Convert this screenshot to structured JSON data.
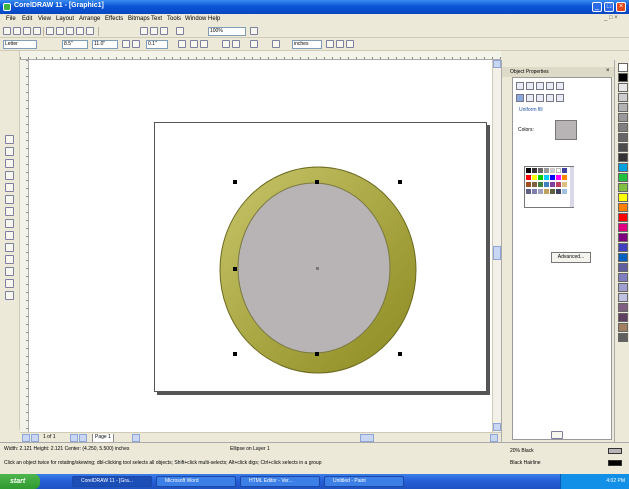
{
  "window": {
    "title": "CorelDRAW 11 - [Graphic1]",
    "minimize_glyph": "_",
    "maximize_glyph": "□",
    "close_glyph": "×"
  },
  "menu": {
    "items": [
      "File",
      "Edit",
      "View",
      "Layout",
      "Arrange",
      "Effects",
      "Bitmaps",
      "Text",
      "Tools",
      "Window",
      "Help"
    ],
    "doc_controls": "_ □ ×"
  },
  "toolbar": {
    "zoom_value": "100%",
    "paper_type": "Letter",
    "width_value": "8.5\"",
    "height_value": "11.0\"",
    "units_value": "inches",
    "nudge_value": "0.1\""
  },
  "docker": {
    "title": "Object Properties",
    "section_label": "Uniform fill",
    "colors_label": "Colors:",
    "advanced_button": "Advanced..."
  },
  "pages": {
    "counter": "1 of 1",
    "tab_label": "Page 1"
  },
  "status": {
    "line1": "Width: 2.121  Height: 2.121  Center: (4.250, 5.500)  inches",
    "layer_text": "Ellipse on Layer 1",
    "line2": "Click an object twice for rotating/skewing; dbl-clicking tool selects all objects; Shift+click multi-selects; Alt+click digs; Ctrl+click selects in a group",
    "fill_text": "20% Black",
    "outline_text": "Black  Hairline"
  },
  "taskbar": {
    "start_label": "start",
    "buttons": [
      "CorelDRAW 11 - [Gra...",
      "Microsoft Word",
      "HTML Editor - Ver...",
      "Untitled - Paint"
    ],
    "clock": "4:02 PM"
  },
  "colors": {
    "ring_light": "#c8c56a",
    "ring_dark": "#8c8a20",
    "inner_fill": "#b8b4b6",
    "inner_stroke": "#7a7840",
    "fill_preview": "#b8b4b6",
    "status_fill_swatch": "#b8b4b6",
    "status_outline_swatch": "#000000"
  },
  "icons": {
    "close": "close-icon",
    "select": "pick-tool-icon",
    "page_nav": "page-nav-icon"
  }
}
